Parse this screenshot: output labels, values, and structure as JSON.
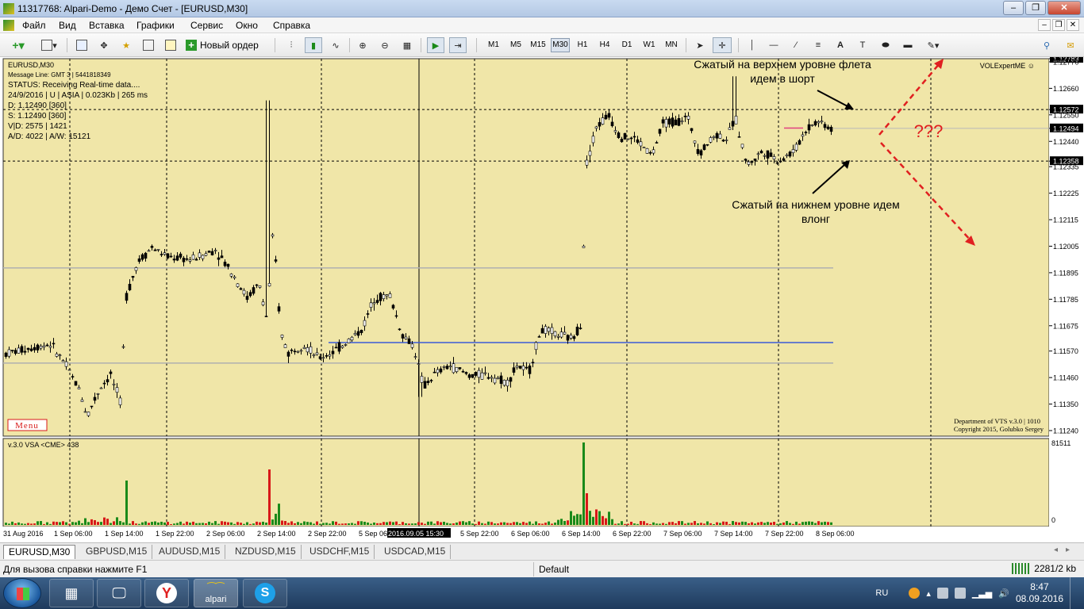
{
  "window": {
    "title": "11317768: Alpari-Demo - Демо Счет - [EURUSD,M30]",
    "min": "–",
    "max": "❐",
    "close": "✕"
  },
  "menu": [
    "Файл",
    "Вид",
    "Вставка",
    "Графики",
    "Сервис",
    "Окно",
    "Справка"
  ],
  "toolbar": {
    "new_order": "Новый ордер",
    "timeframes": [
      "M1",
      "M5",
      "M15",
      "M30",
      "H1",
      "H4",
      "D1",
      "W1",
      "MN"
    ],
    "active_timeframe": "M30"
  },
  "chart": {
    "symbol_line": "EURUSD,M30",
    "info": [
      "Message Line: GMT 3 | 5441818349",
      "STATUS:  Receiving Real-time data....",
      "24/9/2016 | U | ASIA | 0.023Kb | 265 ms",
      "D: 1.12490  [360]",
      "S: 1.12490  [360]",
      "V|D: 2575 | 1421",
      "A/D: 4022 | A/W: 15121"
    ],
    "expert": "VOLExpertME ☺",
    "menu_button": "Menu",
    "copyright_1": "Department of VTS  v.3.0 | 1010",
    "copyright_2": "Copyright 2015, Golubko Sergey",
    "annotation_top_1": "Сжатый на верхнем уровне флета",
    "annotation_top_2": "идем в шорт",
    "annotation_bottom_1": "Сжатый на нижнем уровне идем",
    "annotation_bottom_2": "влонг",
    "question": "???",
    "price_labels": [
      "1.12783",
      "1.12770",
      "1.12660",
      "1.12572",
      "1.12550",
      "1.12494",
      "1.12440",
      "1.12358",
      "1.12335",
      "1.12225",
      "1.12115",
      "1.12005",
      "1.11895",
      "1.11785",
      "1.11675",
      "1.11570",
      "1.11460",
      "1.11350",
      "1.11240"
    ],
    "highlight_prices": [
      "1.12783",
      "1.12572",
      "1.12494",
      "1.12358"
    ],
    "time_labels": [
      "31 Aug 2016",
      "1 Sep 06:00",
      "1 Sep 14:00",
      "1 Sep 22:00",
      "2 Sep 06:00",
      "2 Sep 14:00",
      "2 Sep 22:00",
      "5 Sep 06",
      "2016.09.05 15:30",
      "5 Sep 22:00",
      "6 Sep 06:00",
      "6 Sep 14:00",
      "6 Sep 22:00",
      "7 Sep 06:00",
      "7 Sep 14:00",
      "7 Sep 22:00",
      "8 Sep 06:00"
    ],
    "volume_title": "v.3.0 VSA <CME> 438",
    "volume_max": "81511",
    "volume_zero": "0"
  },
  "tabs": [
    "EURUSD,M30",
    "GBPUSD,M15",
    "AUDUSD,M15",
    "NZDUSD,M15",
    "USDCHF,M15",
    "USDCAD,M15"
  ],
  "status": {
    "help": "Для вызова справки нажмите F1",
    "profile": "Default",
    "connection": "2281/2 kb"
  },
  "taskbar": {
    "lang": "RU",
    "time": "8:47",
    "date": "08.09.2016",
    "alpari": "alpari"
  },
  "colors": {
    "chart_bg": "#f0e6a8",
    "grid": "#000000",
    "level_blue": "#3a5ad8",
    "up_volume": "#1a8a1a",
    "down_volume": "#d81818",
    "annotation_red": "#e02020"
  }
}
